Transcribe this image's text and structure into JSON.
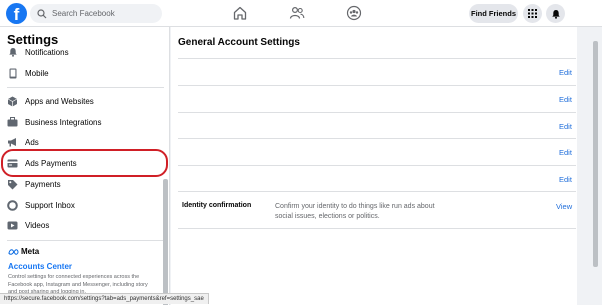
{
  "header": {
    "logo_letter": "f",
    "search_placeholder": "Search Facebook",
    "find_friends_label": "Find Friends",
    "nav_icons": [
      "home-icon",
      "friends-icon",
      "groups-icon"
    ],
    "right_icons": [
      "grid-menu-icon",
      "bell-icon"
    ]
  },
  "sidebar": {
    "title": "Settings",
    "items": [
      {
        "label": "Notifications",
        "icon": "bell-icon"
      },
      {
        "label": "Mobile",
        "icon": "phone-icon"
      },
      {
        "label": "Apps and Websites",
        "icon": "cube-icon"
      },
      {
        "label": "Business Integrations",
        "icon": "briefcase-icon"
      },
      {
        "label": "Ads",
        "icon": "megaphone-icon"
      },
      {
        "label": "Ads Payments",
        "icon": "ads-payments-icon",
        "highlighted": true
      },
      {
        "label": "Payments",
        "icon": "tag-icon"
      },
      {
        "label": "Support Inbox",
        "icon": "lifebuoy-icon"
      },
      {
        "label": "Videos",
        "icon": "play-icon"
      }
    ],
    "meta_label": "Meta",
    "accounts_center": "Accounts Center",
    "accounts_center_desc": "Control settings for connected experiences across the Facebook app, Instagram and Messenger, including story and post sharing and logging in."
  },
  "main": {
    "title": "General Account Settings",
    "edit_label": "Edit",
    "identity": {
      "label": "Identity confirmation",
      "description": "Confirm your identity to do things like run ads about social issues, elections or politics.",
      "action": "View"
    }
  },
  "status_url": "https://secure.facebook.com/settings?tab=ads_payments&ref=settings_sae",
  "colors": {
    "brand": "#1877f2",
    "link": "#216fdb",
    "highlight_ring": "#d01f26",
    "background": "#f0f2f5"
  }
}
